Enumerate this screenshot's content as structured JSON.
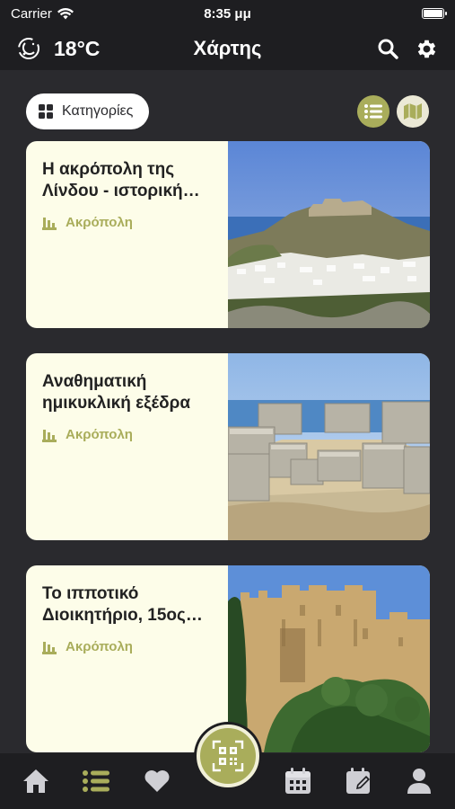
{
  "status_bar": {
    "carrier": "Carrier",
    "time": "8:35 μμ"
  },
  "header": {
    "temperature": "18°C",
    "title": "Χάρτης",
    "weather_icon": "night-cloud-icon",
    "search_icon": "search-icon",
    "settings_icon": "gear-icon"
  },
  "toolbar": {
    "categories_label": "Κατηγορίες",
    "view_modes": [
      "list",
      "map"
    ],
    "active_view": "list"
  },
  "cards": [
    {
      "title": "Η ακρόπολη της Λίνδου - ιστορική…",
      "category": "Ακρόπολη"
    },
    {
      "title": "Αναθηματική ημικυκλική εξέδρα",
      "category": "Ακρόπολη"
    },
    {
      "title": "Το ιπποτικό Διοικητήριο, 15ος…",
      "category": "Ακρόπολη"
    }
  ],
  "tab_bar": {
    "items": [
      "home-icon",
      "list-icon",
      "heart-icon",
      "qr-scan-icon",
      "calendar-icon",
      "edit-calendar-icon",
      "profile-icon"
    ],
    "active": "list-icon"
  },
  "colors": {
    "accent": "#a9ad5b",
    "card_bg": "#fdfde9",
    "page_bg": "#2a2a2e",
    "bar_bg": "#1e1e21"
  }
}
